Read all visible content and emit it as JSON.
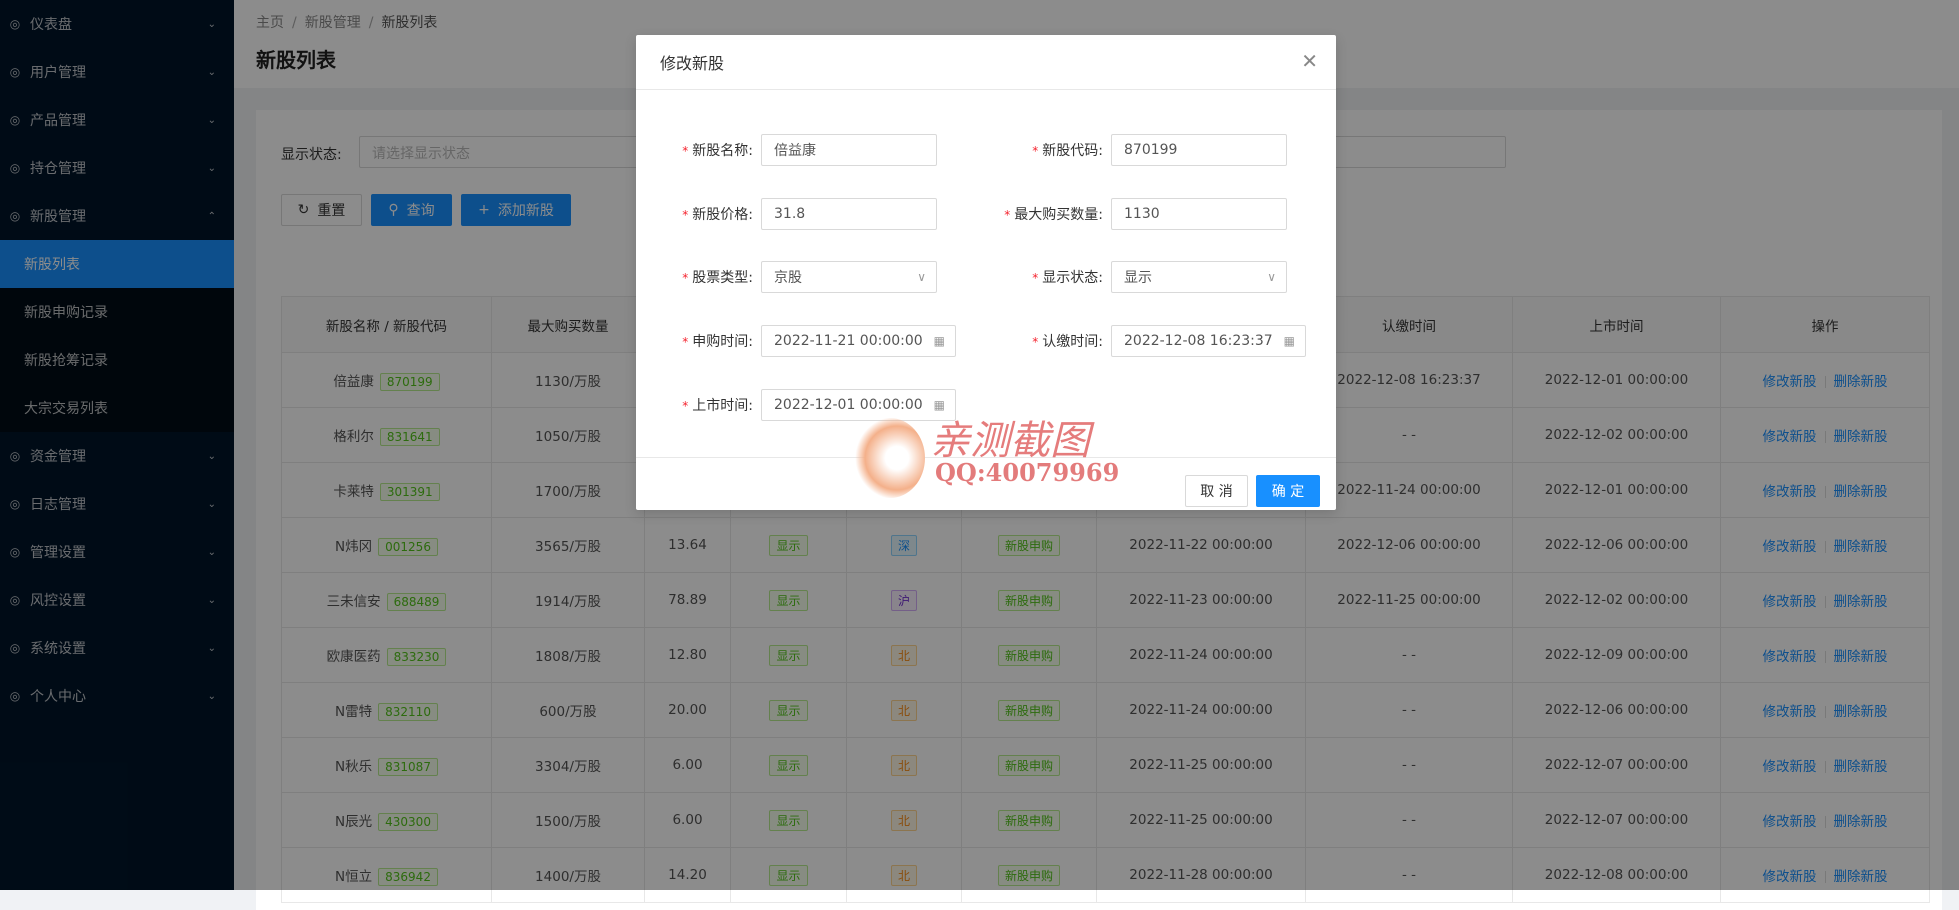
{
  "sidebar": {
    "items": [
      {
        "label": "仪表盘",
        "icon": "dashboard-icon",
        "chev": "⌄"
      },
      {
        "label": "用户管理",
        "icon": "user-icon",
        "chev": "⌄"
      },
      {
        "label": "产品管理",
        "icon": "chart-icon",
        "chev": "⌄"
      },
      {
        "label": "持仓管理",
        "icon": "position-icon",
        "chev": "⌄"
      },
      {
        "label": "新股管理",
        "icon": "ipo-icon",
        "chev": "⌃"
      }
    ],
    "sub_items": [
      {
        "label": "新股列表"
      },
      {
        "label": "新股申购记录"
      },
      {
        "label": "新股抢筹记录"
      },
      {
        "label": "大宗交易列表"
      }
    ],
    "items_after": [
      {
        "label": "资金管理",
        "icon": "money-icon",
        "chev": "⌄"
      },
      {
        "label": "日志管理",
        "icon": "log-icon",
        "chev": "⌄"
      },
      {
        "label": "管理设置",
        "icon": "settings-panel-icon",
        "chev": "⌄"
      },
      {
        "label": "风控设置",
        "icon": "warning-icon",
        "chev": "⌄"
      },
      {
        "label": "系统设置",
        "icon": "gear-icon",
        "chev": "⌄"
      },
      {
        "label": "个人中心",
        "icon": "person-icon",
        "chev": "⌄"
      }
    ]
  },
  "breadcrumb": [
    "主页",
    "新股管理",
    "新股列表"
  ],
  "page_title": "新股列表",
  "filter": {
    "label": "显示状态:",
    "placeholder": "请选择显示状态"
  },
  "buttons": {
    "reset": "重置",
    "query": "查询",
    "add": "添加新股"
  },
  "table": {
    "headers": [
      "新股名称 / 新股代码",
      "最大购买数量",
      "",
      "",
      "",
      "",
      "",
      "认缴时间",
      "上市时间",
      "操作"
    ],
    "actions": {
      "edit": "修改新股",
      "delete": "删除新股"
    },
    "rows": [
      {
        "name": "倍益康",
        "code": "870199",
        "qty": "1130/万股",
        "price": "",
        "status": "",
        "market": "",
        "mclass": "",
        "type": "",
        "apply": "",
        "pay": "2022-12-08 16:23:37",
        "list": "2022-12-01 00:00:00"
      },
      {
        "name": "格利尔",
        "code": "831641",
        "qty": "1050/万股",
        "price": "",
        "status": "",
        "market": "",
        "mclass": "",
        "type": "",
        "apply": "",
        "pay": "- -",
        "list": "2022-12-02 00:00:00"
      },
      {
        "name": "卡莱特",
        "code": "301391",
        "qty": "1700/万股",
        "price": "",
        "status": "",
        "market": "",
        "mclass": "",
        "type": "",
        "apply": "",
        "pay": "2022-11-24 00:00:00",
        "list": "2022-12-01 00:00:00"
      },
      {
        "name": "N炜冈",
        "code": "001256",
        "qty": "3565/万股",
        "price": "13.64",
        "status": "显示",
        "market": "深",
        "mclass": "blue",
        "type": "新股申购",
        "apply": "2022-11-22 00:00:00",
        "pay": "2022-12-06 00:00:00",
        "list": "2022-12-06 00:00:00"
      },
      {
        "name": "三未信安",
        "code": "688489",
        "qty": "1914/万股",
        "price": "78.89",
        "status": "显示",
        "market": "沪",
        "mclass": "purple",
        "type": "新股申购",
        "apply": "2022-11-23 00:00:00",
        "pay": "2022-11-25 00:00:00",
        "list": "2022-12-02 00:00:00"
      },
      {
        "name": "欧康医药",
        "code": "833230",
        "qty": "1808/万股",
        "price": "12.80",
        "status": "显示",
        "market": "北",
        "mclass": "orange",
        "type": "新股申购",
        "apply": "2022-11-24 00:00:00",
        "pay": "- -",
        "list": "2022-12-09 00:00:00"
      },
      {
        "name": "N雷特",
        "code": "832110",
        "qty": "600/万股",
        "price": "20.00",
        "status": "显示",
        "market": "北",
        "mclass": "orange",
        "type": "新股申购",
        "apply": "2022-11-24 00:00:00",
        "pay": "- -",
        "list": "2022-12-06 00:00:00"
      },
      {
        "name": "N秋乐",
        "code": "831087",
        "qty": "3304/万股",
        "price": "6.00",
        "status": "显示",
        "market": "北",
        "mclass": "orange",
        "type": "新股申购",
        "apply": "2022-11-25 00:00:00",
        "pay": "- -",
        "list": "2022-12-07 00:00:00"
      },
      {
        "name": "N辰光",
        "code": "430300",
        "qty": "1500/万股",
        "price": "6.00",
        "status": "显示",
        "market": "北",
        "mclass": "orange",
        "type": "新股申购",
        "apply": "2022-11-25 00:00:00",
        "pay": "- -",
        "list": "2022-12-07 00:00:00"
      },
      {
        "name": "N恒立",
        "code": "836942",
        "qty": "1400/万股",
        "price": "14.20",
        "status": "显示",
        "market": "北",
        "mclass": "orange",
        "type": "新股申购",
        "apply": "2022-11-28 00:00:00",
        "pay": "- -",
        "list": "2022-12-08 00:00:00"
      }
    ]
  },
  "modal": {
    "title": "修改新股",
    "fields": {
      "name": {
        "label": "新股名称:",
        "value": "倍益康"
      },
      "code": {
        "label": "新股代码:",
        "value": "870199"
      },
      "price": {
        "label": "新股价格:",
        "value": "31.8"
      },
      "max_qty": {
        "label": "最大购买数量:",
        "value": "1130"
      },
      "stock_type": {
        "label": "股票类型:",
        "value": "京股"
      },
      "display": {
        "label": "显示状态:",
        "value": "显示"
      },
      "apply_time": {
        "label": "申购时间:",
        "value": "2022-11-21 00:00:00"
      },
      "pay_time": {
        "label": "认缴时间:",
        "value": "2022-12-08 16:23:37"
      },
      "list_time": {
        "label": "上市时间:",
        "value": "2022-12-01 00:00:00"
      }
    },
    "required_mark": "*",
    "cancel": "取 消",
    "confirm": "确 定"
  },
  "watermark": {
    "title": "亲测截图",
    "qq": "QQ:40079969"
  },
  "colors": {
    "primary": "#1890ff",
    "sidebar": "#001529"
  }
}
